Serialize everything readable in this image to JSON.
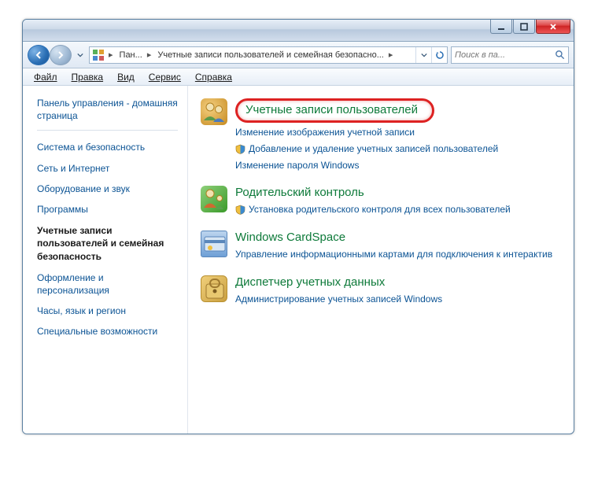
{
  "titlebar": {},
  "breadcrumbs": {
    "item1": "Пан...",
    "item2": "Учетные записи пользователей и семейная безопасно..."
  },
  "search": {
    "placeholder": "Поиск в па..."
  },
  "menu": {
    "file": "Файл",
    "edit": "Правка",
    "view": "Вид",
    "tools": "Сервис",
    "help": "Справка"
  },
  "sidebar": {
    "home": "Панель управления - домашняя страница",
    "items": [
      "Система и безопасность",
      "Сеть и Интернет",
      "Оборудование и звук",
      "Программы"
    ],
    "current": "Учетные записи пользователей и семейная безопасность",
    "items_after": [
      "Оформление и персонализация",
      "Часы, язык и регион",
      "Специальные возможности"
    ]
  },
  "sections": {
    "user_accounts": {
      "title": "Учетные записи пользователей",
      "links": {
        "change_picture": "Изменение изображения учетной записи",
        "add_remove": "Добавление и удаление учетных записей пользователей",
        "change_pw": "Изменение пароля Windows"
      }
    },
    "parental": {
      "title": "Родительский контроль",
      "link": "Установка родительского контроля для всех пользователей"
    },
    "cardspace": {
      "title": "Windows CardSpace",
      "link": "Управление информационными картами для подключения к интерактив"
    },
    "credentials": {
      "title": "Диспетчер учетных данных",
      "link": "Администрирование учетных записей Windows"
    }
  }
}
